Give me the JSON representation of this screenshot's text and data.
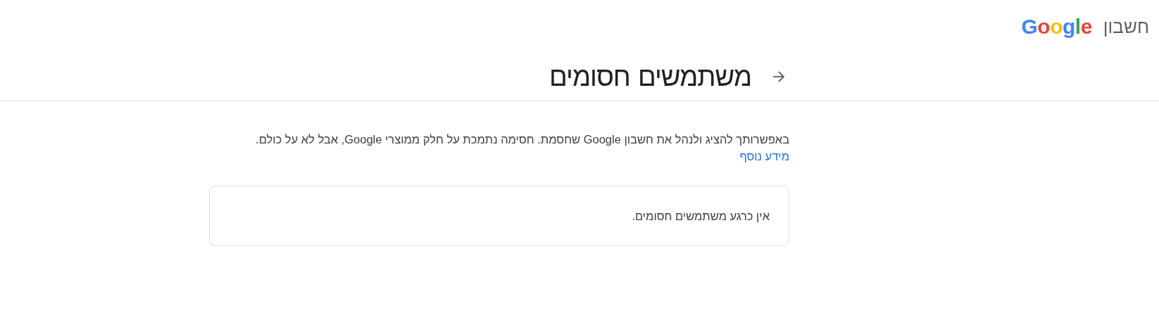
{
  "header": {
    "logo": "Google",
    "product": "חשבון"
  },
  "page": {
    "title": "משתמשים חסומים"
  },
  "description": "באפשרותך להציג ולנהל את חשבון Google שחסמת. חסימה נתמכת על חלק ממוצרי Google, אבל לא על כולם.",
  "learn_more_link": "מידע נוסף",
  "blocked_list": {
    "empty_message": "אין כרגע משתמשים חסומים."
  }
}
